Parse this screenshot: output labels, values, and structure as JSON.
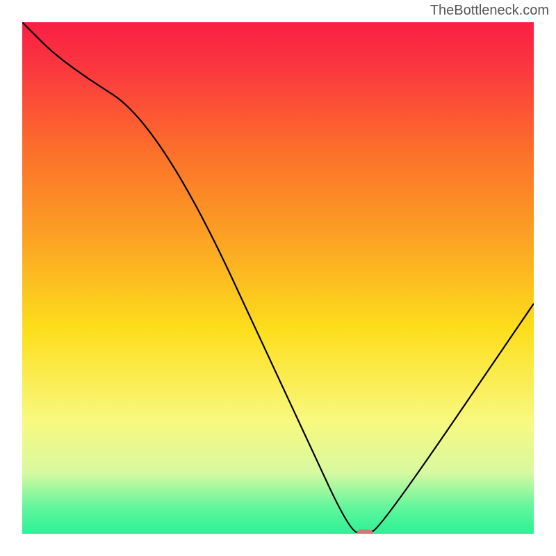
{
  "watermark": "TheBottleneck.com",
  "chart_data": {
    "type": "line",
    "title": "",
    "xlabel": "",
    "ylabel": "",
    "xlim": [
      0,
      100
    ],
    "ylim": [
      0,
      100
    ],
    "grid": false,
    "series": [
      {
        "name": "curve",
        "x": [
          0,
          8,
          27,
          55,
          64,
          67,
          70,
          100
        ],
        "values": [
          100,
          92,
          80,
          20,
          0.5,
          0,
          1,
          45
        ]
      }
    ],
    "marker": {
      "x": 67,
      "y": 0
    },
    "gradient_colors": [
      "#f91e44",
      "#fc6f2a",
      "#fdde1c",
      "#f8f97f",
      "#2cf096"
    ]
  }
}
